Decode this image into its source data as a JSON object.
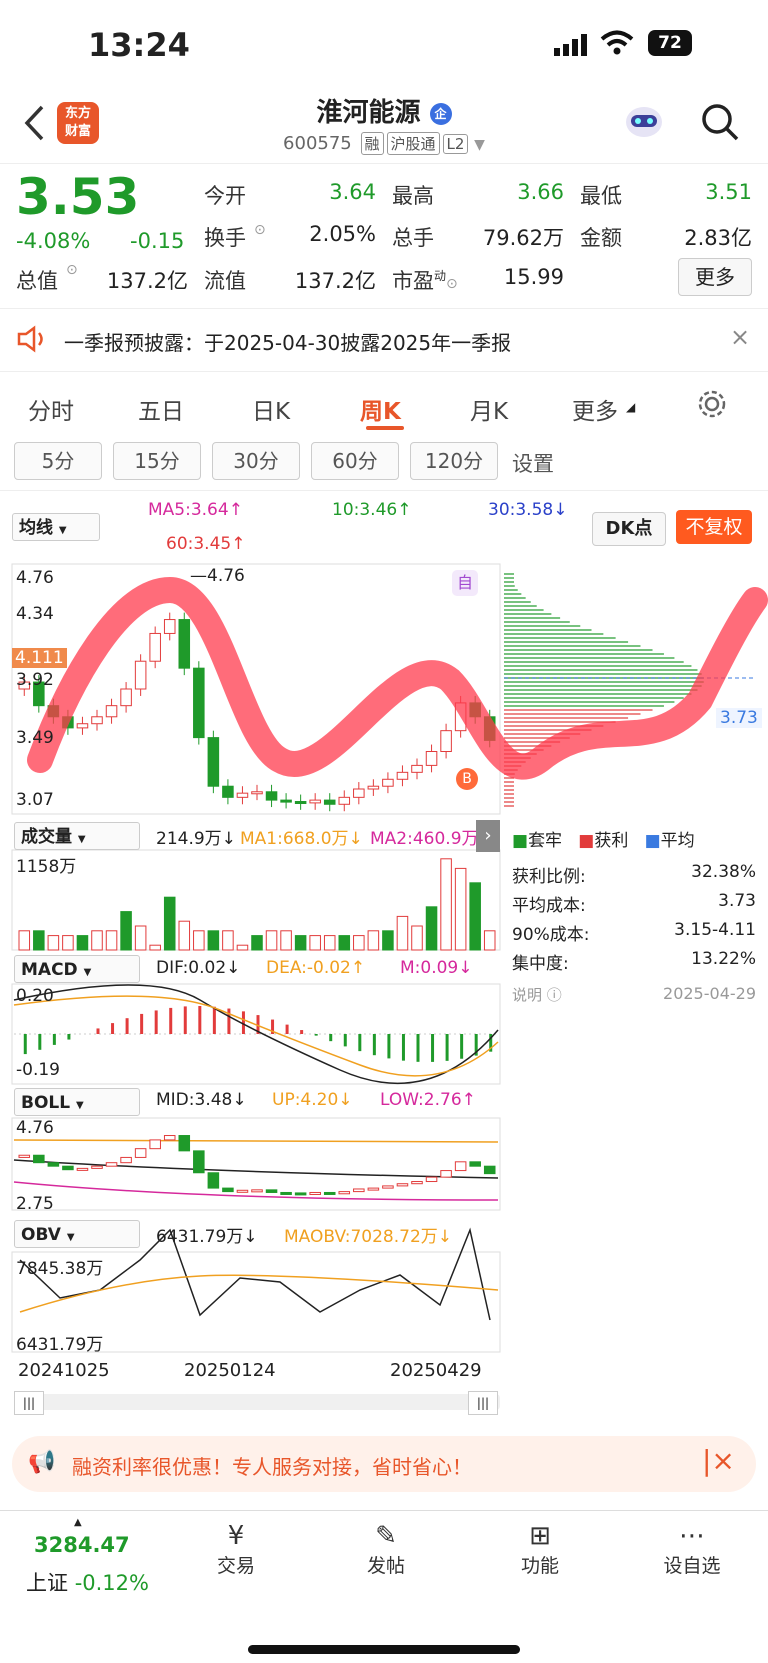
{
  "status": {
    "time": "13:24",
    "battery": "72"
  },
  "header": {
    "logo_line1": "东方",
    "logo_line2": "财富",
    "stock_name": "淮河能源",
    "badge": "企",
    "code": "600575",
    "tags": [
      "融",
      "沪股通",
      "L2"
    ]
  },
  "quote": {
    "price": "3.53",
    "change_pct": "-4.08%",
    "change": "-0.15",
    "open_label": "今开",
    "open": "3.64",
    "high_label": "最高",
    "high": "3.66",
    "low_label": "最低",
    "low": "3.51",
    "turnover_label": "换手",
    "turnover": "2.05%",
    "volume_label": "总手",
    "volume": "79.62万",
    "amount_label": "金额",
    "amount": "2.83亿",
    "mcap_label": "总值",
    "mcap": "137.2亿",
    "float_label": "流值",
    "float": "137.2亿",
    "pe_label": "市盈",
    "pe_sup": "动",
    "pe": "15.99",
    "more": "更多"
  },
  "notice": {
    "text": "一季报预披露：于2025-04-30披露2025年一季报"
  },
  "tabs": [
    "分时",
    "五日",
    "日K",
    "周K",
    "月K",
    "更多"
  ],
  "active_tab": "周K",
  "period_tabs": [
    "5分",
    "15分",
    "30分",
    "60分",
    "120分",
    "设置"
  ],
  "ma": {
    "selector": "均线",
    "ma5": "MA5:3.64↑",
    "ma10": "10:3.46↑",
    "ma30": "30:3.58↓",
    "ma60": "60:3.45↑",
    "dk": "DK点",
    "fq": "不复权"
  },
  "main_chart": {
    "y_top": "4.76",
    "y_mid1": "4.34",
    "y_mark": "4.111",
    "y_mid2": "3.92",
    "y_mid3": "3.49",
    "y_bot": "3.07",
    "hi_mark": "4.76",
    "self_tag": "自",
    "b_tag": "B"
  },
  "vol": {
    "selector": "成交量",
    "value": "214.9万↓",
    "ma1": "MA1:668.0万↓",
    "ma2": "MA2:460.9万",
    "max": "1158万"
  },
  "macd": {
    "selector": "MACD",
    "dif": "DIF:0.02↓",
    "dea": "DEA:-0.02↑",
    "m": "M:0.09↓",
    "top": "0.20",
    "bot": "-0.19"
  },
  "boll": {
    "selector": "BOLL",
    "mid": "MID:3.48↓",
    "up": "UP:4.20↓",
    "low": "LOW:2.76↑",
    "top": "4.76",
    "bot": "2.75"
  },
  "obv": {
    "selector": "OBV",
    "value": "6431.79万↓",
    "maobv": "MAOBV:7028.72万↓",
    "top": "7845.38万",
    "bot": "6431.79万"
  },
  "dates": [
    "20241025",
    "20250124",
    "20250429"
  ],
  "chip": {
    "legend": [
      "套牢",
      "获利",
      "平均"
    ],
    "price_tag": "3.73",
    "rows": [
      {
        "k": "获利比例:",
        "v": "32.38%"
      },
      {
        "k": "平均成本:",
        "v": "3.73"
      },
      {
        "k": "90%成本:",
        "v": "3.15-4.11"
      },
      {
        "k": "集中度:",
        "v": "13.22%"
      }
    ],
    "note": "说明",
    "date": "2025-04-29"
  },
  "ad": {
    "text": "融资利率很优惠！专人服务对接，省时省心！"
  },
  "bottom": {
    "index_value": "3284.47",
    "index_name": "上证",
    "index_change": "-0.12%",
    "nav": [
      {
        "icon": "trade-icon",
        "label": "交易"
      },
      {
        "icon": "post-icon",
        "label": "发帖"
      },
      {
        "icon": "function-icon",
        "label": "功能"
      },
      {
        "icon": "watchlist-icon",
        "label": "设自选"
      }
    ]
  },
  "colors": {
    "up": "#e23b3b",
    "down": "#1f9a2a",
    "accent": "#ff5a1f"
  }
}
